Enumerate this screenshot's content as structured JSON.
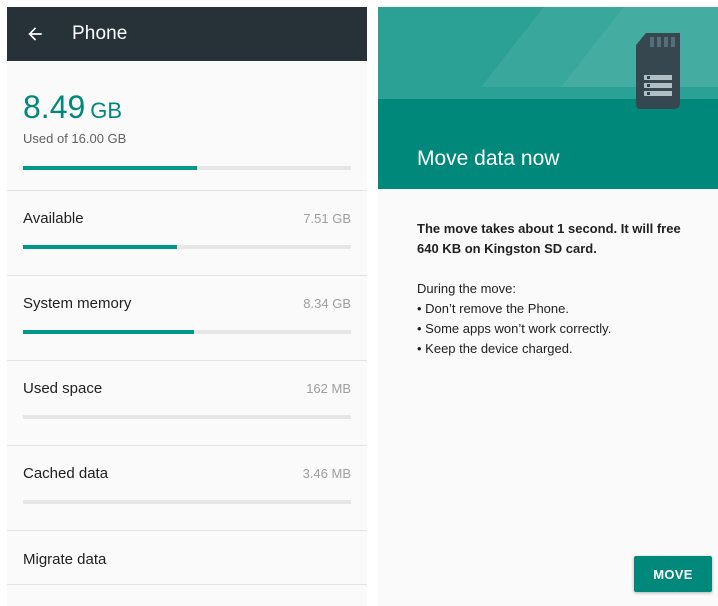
{
  "left": {
    "appbar": {
      "title": "Phone",
      "back_icon": "arrow-back-icon"
    },
    "summary": {
      "size": "8.49",
      "unit": "GB",
      "subtitle": "Used of 16.00 GB",
      "fraction": 0.53
    },
    "items": [
      {
        "label": "Available",
        "value": "7.51 GB",
        "fraction": 0.47
      },
      {
        "label": "System memory",
        "value": "8.34 GB",
        "fraction": 0.52
      },
      {
        "label": "Used space",
        "value": "162 MB",
        "fraction": 0.0
      },
      {
        "label": "Cached data",
        "value": "3.46 MB",
        "fraction": 0.0
      }
    ],
    "migrate": {
      "label": "Migrate data"
    }
  },
  "right": {
    "title": "Move data now",
    "message_bold_line1": "The move takes about 1 second. It will free",
    "message_bold_line2": "640 KB on Kingston SD card.",
    "during": "During the move:",
    "bullets": [
      "• Don’t remove the Phone.",
      "• Some apps won’t work correctly.",
      "• Keep the device charged."
    ],
    "button_label": "MOVE",
    "hero_icon": "sd-card-icon"
  },
  "colors": {
    "accent": "#009688",
    "appbar": "#263238",
    "hero": "#00897b"
  }
}
